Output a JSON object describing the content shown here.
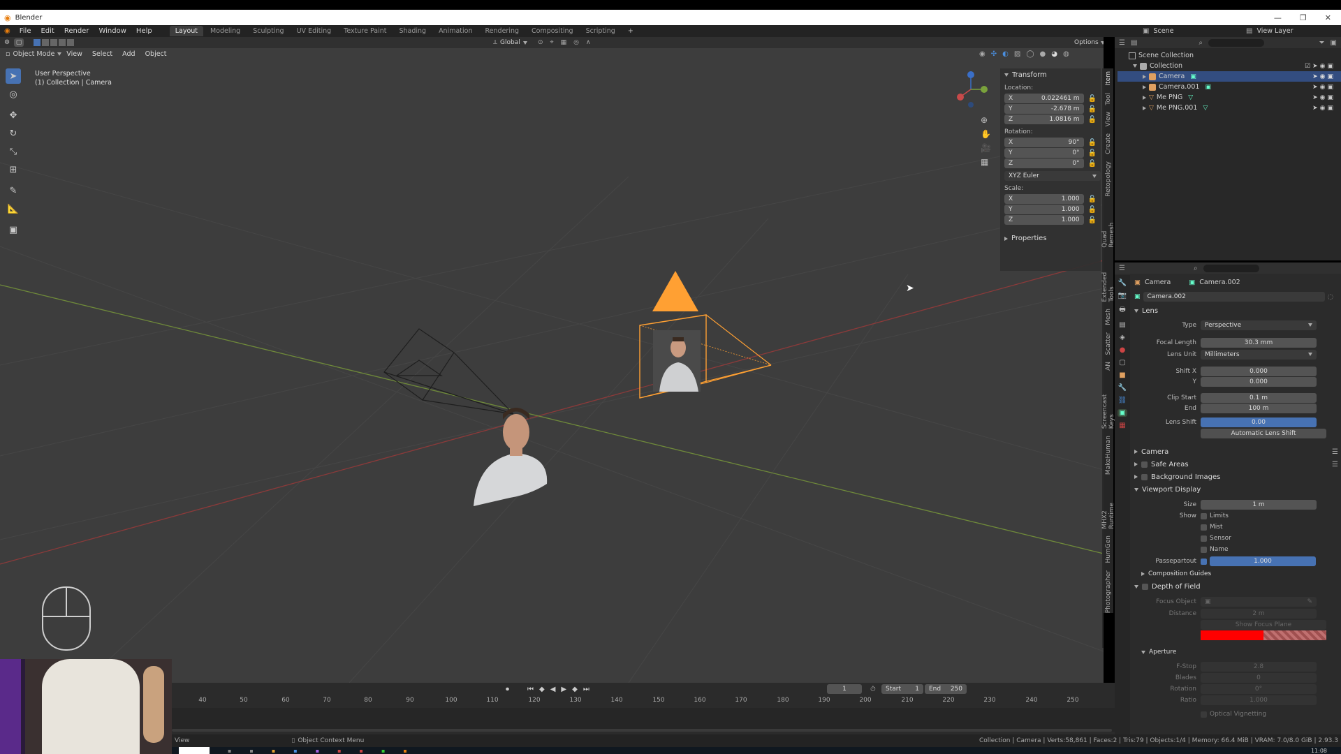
{
  "window": {
    "title": "Blender"
  },
  "topmenu": [
    "File",
    "Edit",
    "Render",
    "Window",
    "Help"
  ],
  "workspaces": [
    {
      "label": "Layout",
      "active": true
    },
    {
      "label": "Modeling"
    },
    {
      "label": "Sculpting"
    },
    {
      "label": "UV Editing"
    },
    {
      "label": "Texture Paint"
    },
    {
      "label": "Shading"
    },
    {
      "label": "Animation"
    },
    {
      "label": "Rendering"
    },
    {
      "label": "Compositing"
    },
    {
      "label": "Scripting"
    }
  ],
  "scene": {
    "label": "Scene",
    "view_layer": "View Layer"
  },
  "header": {
    "mode": "Object Mode",
    "menus": [
      "View",
      "Select",
      "Add",
      "Object"
    ],
    "transform_orientation": "Global",
    "options": "Options"
  },
  "viewport": {
    "perspective": "User Perspective",
    "collection_info": "(1) Collection | Camera"
  },
  "npanel": {
    "transform_title": "Transform",
    "location_label": "Location:",
    "location": [
      {
        "axis": "X",
        "value": "0.022461 m"
      },
      {
        "axis": "Y",
        "value": "-2.678 m"
      },
      {
        "axis": "Z",
        "value": "1.0816 m"
      }
    ],
    "rotation_label": "Rotation:",
    "rotation": [
      {
        "axis": "X",
        "value": "90°"
      },
      {
        "axis": "Y",
        "value": "0°"
      },
      {
        "axis": "Z",
        "value": "0°"
      }
    ],
    "rotation_mode": "XYZ Euler",
    "scale_label": "Scale:",
    "scale": [
      {
        "axis": "X",
        "value": "1.000"
      },
      {
        "axis": "Y",
        "value": "1.000"
      },
      {
        "axis": "Z",
        "value": "1.000"
      }
    ],
    "properties_title": "Properties",
    "tabs": [
      "Item",
      "Tool",
      "View",
      "Create",
      "Retopology",
      "Quad Remesh",
      "Extended Tools",
      "Mesh",
      "Scatter",
      "AN",
      "Screencast Keys",
      "MakeHuman",
      "MHX2 Runtime",
      "HumGen",
      "Photographer"
    ]
  },
  "outliner": {
    "root": "Scene Collection",
    "collection": "Collection",
    "items": [
      {
        "label": "Camera",
        "selected": true,
        "type": "camera"
      },
      {
        "label": "Camera.001",
        "selected": false,
        "type": "camera"
      },
      {
        "label": "Me PNG",
        "selected": false,
        "type": "mesh"
      },
      {
        "label": "Me PNG.001",
        "selected": false,
        "type": "mesh"
      }
    ]
  },
  "properties": {
    "object_name": "Camera",
    "data_name": "Camera.002",
    "datablock": "Camera.002",
    "lens": {
      "title": "Lens",
      "type_label": "Type",
      "type_value": "Perspective",
      "focal_label": "Focal Length",
      "focal_value": "30.3 mm",
      "lens_unit_label": "Lens Unit",
      "lens_unit_value": "Millimeters",
      "shift_x_label": "Shift X",
      "shift_x_value": "0.000",
      "shift_y_label": "Y",
      "shift_y_value": "0.000",
      "clip_start_label": "Clip Start",
      "clip_start_value": "0.1 m",
      "clip_end_label": "End",
      "clip_end_value": "100 m",
      "lens_shift_label": "Lens Shift",
      "lens_shift_value": "0.00",
      "auto_lens_shift": "Automatic Lens Shift"
    },
    "sections": {
      "camera": "Camera",
      "safe_areas": "Safe Areas",
      "background_images": "Background Images",
      "viewport_display": "Viewport Display"
    },
    "viewport_display": {
      "size_label": "Size",
      "size_value": "1 m",
      "show_label": "Show",
      "show_items": [
        "Limits",
        "Mist",
        "Sensor",
        "Name"
      ],
      "passepartout_label": "Passepartout",
      "passepartout_value": "1.000",
      "composition_guides": "Composition Guides"
    },
    "dof": {
      "title": "Depth of Field",
      "focus_object_label": "Focus Object",
      "distance_label": "Distance",
      "distance_value": "2 m",
      "show_focus_plane": "Show Focus Plane",
      "aperture": "Aperture",
      "fstop_label": "F-Stop",
      "fstop_value": "2.8",
      "blades_label": "Blades",
      "blades_value": "0",
      "rotation_label": "Rotation",
      "rotation_value": "0°",
      "ratio_label": "Ratio",
      "ratio_value": "1.000",
      "optical_vignetting": "Optical Vignetting"
    }
  },
  "timeline": {
    "current_frame": "1",
    "start_label": "Start",
    "start_value": "1",
    "end_label": "End",
    "end_value": "250",
    "ticks": [
      "40",
      "50",
      "60",
      "70",
      "80",
      "90",
      "100",
      "110",
      "120",
      "130",
      "140",
      "150",
      "160",
      "170",
      "180",
      "190",
      "200",
      "210",
      "220",
      "230",
      "240",
      "250"
    ]
  },
  "statusbar": {
    "left": "View",
    "middle": "Object Context Menu",
    "right": "Collection | Camera | Verts:58,861 | Faces:2 | Tris:79 | Objects:1/4 | Memory: 66.4 MiB | VRAM: 7.0/8.0 GiB | 2.93.3"
  },
  "taskbar": {
    "clock": "11:08"
  },
  "colors": {
    "accent": "#4772b3",
    "selection_orange": "#ffa033",
    "viewport_bg": "#3d3d3d",
    "panel_bg": "#303030",
    "x_axis": "#a83c3c",
    "y_axis": "#7a9a3a"
  }
}
